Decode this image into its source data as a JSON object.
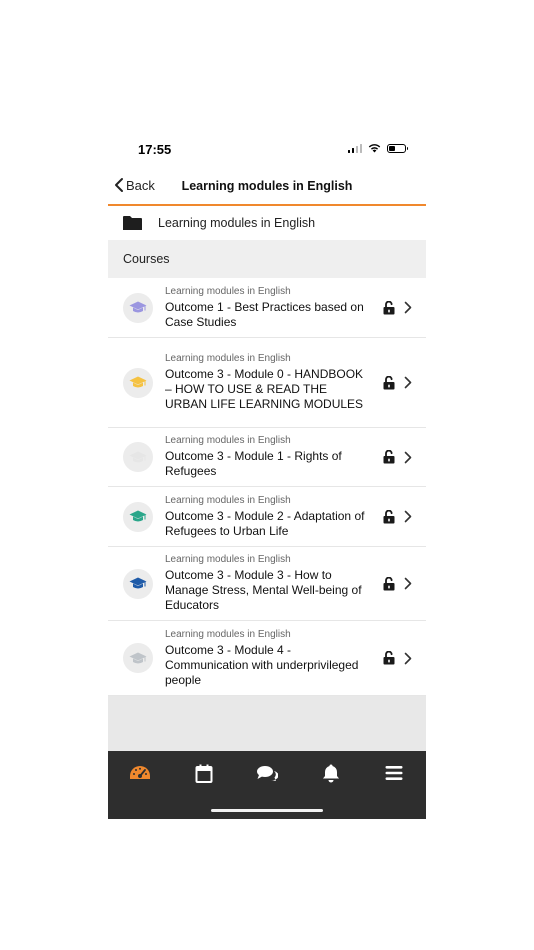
{
  "status_bar": {
    "time": "17:55"
  },
  "header": {
    "back_label": "Back",
    "title": "Learning modules in English"
  },
  "breadcrumb": {
    "folder_label": "Learning modules in English"
  },
  "section": {
    "title": "Courses"
  },
  "courses": [
    {
      "category": "Learning modules in English",
      "name": "Outcome 1 - Best Practices based on Case Studies",
      "icon_color": "#9b96e0"
    },
    {
      "category": "Learning modules in English",
      "name": "Outcome 3 - Module 0 - HANDBOOK – HOW TO USE & READ THE URBAN LIFE LEARNING MODULES",
      "icon_color": "#f5c242"
    },
    {
      "category": "Learning modules in English",
      "name": "Outcome 3 - Module 1 - Rights of Refugees",
      "icon_color": "#e6e6e6"
    },
    {
      "category": "Learning modules in English",
      "name": "Outcome 3 - Module 2 - Adaptation of Refugees to Urban Life",
      "icon_color": "#2aa68a"
    },
    {
      "category": "Learning modules in English",
      "name": "Outcome 3 - Module 3 - How to Manage Stress, Mental Well-being of Educators",
      "icon_color": "#1f5ba8"
    },
    {
      "category": "Learning modules in English",
      "name": "Outcome 3 - Module 4 - Communication with underprivileged people",
      "icon_color": "#bfc4c9"
    }
  ],
  "tabbar": {
    "items": [
      "dashboard-icon",
      "calendar-icon",
      "messages-icon",
      "notifications-icon",
      "menu-icon"
    ],
    "active_color": "#f0882d",
    "inactive_color": "#ffffff"
  }
}
